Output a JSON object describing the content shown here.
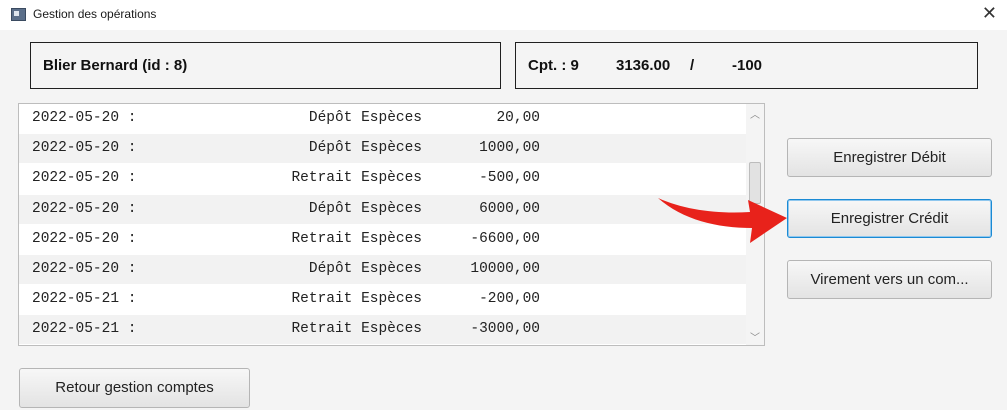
{
  "window": {
    "title": "Gestion des opérations",
    "close_glyph": "✕"
  },
  "client_info": "Blier  Bernard  (id : 8)",
  "account_info": {
    "account_label": "Cpt. : 9",
    "balance": "3136.00",
    "separator": "/",
    "overdraft": "-100"
  },
  "operations": [
    {
      "date": "2022-05-20 :",
      "type": "Dépôt Espèces",
      "amount": "20,00"
    },
    {
      "date": "2022-05-20 :",
      "type": "Dépôt Espèces",
      "amount": "1000,00"
    },
    {
      "date": "2022-05-20 :",
      "type": "Retrait Espèces",
      "amount": "-500,00"
    },
    {
      "date": "2022-05-20 :",
      "type": "Dépôt Espèces",
      "amount": "6000,00"
    },
    {
      "date": "2022-05-20 :",
      "type": "Retrait Espèces",
      "amount": "-6600,00"
    },
    {
      "date": "2022-05-20 :",
      "type": "Dépôt Espèces",
      "amount": "10000,00"
    },
    {
      "date": "2022-05-21 :",
      "type": "Retrait Espèces",
      "amount": "-200,00"
    },
    {
      "date": "2022-05-21 :",
      "type": "Retrait Espèces",
      "amount": "-3000,00"
    }
  ],
  "buttons": {
    "debit": "Enregistrer Débit",
    "credit": "Enregistrer Crédit",
    "virement": "Virement vers un com...",
    "retour": "Retour gestion comptes"
  },
  "scrollbar": {
    "up_glyph": "︿",
    "down_glyph": "﹀"
  },
  "colors": {
    "arrow": "#e8221b",
    "focus_border": "#1a8ad4"
  }
}
